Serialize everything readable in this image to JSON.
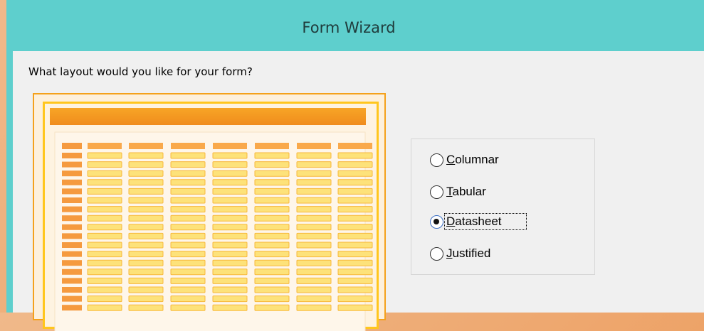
{
  "window": {
    "title": "Form Wizard"
  },
  "wizard": {
    "prompt": "What layout would you like for your form?",
    "options": [
      {
        "id": "columnar",
        "first": "C",
        "rest": "olumnar",
        "checked": false
      },
      {
        "id": "tabular",
        "first": "T",
        "rest": "abular",
        "checked": false
      },
      {
        "id": "datasheet",
        "first": "D",
        "rest": "atasheet",
        "checked": true
      },
      {
        "id": "justified",
        "first": "J",
        "rest": "ustified",
        "checked": false
      }
    ],
    "selected": "Datasheet"
  },
  "preview": {
    "layout": "datasheet",
    "colors": {
      "header_bar": "#f39b22",
      "column_header": "#f9a94b",
      "row_header": "#f59a3f",
      "cell_fill": "#fde27a",
      "cell_border": "#f8b83a",
      "frame": "#ffc61e"
    }
  }
}
